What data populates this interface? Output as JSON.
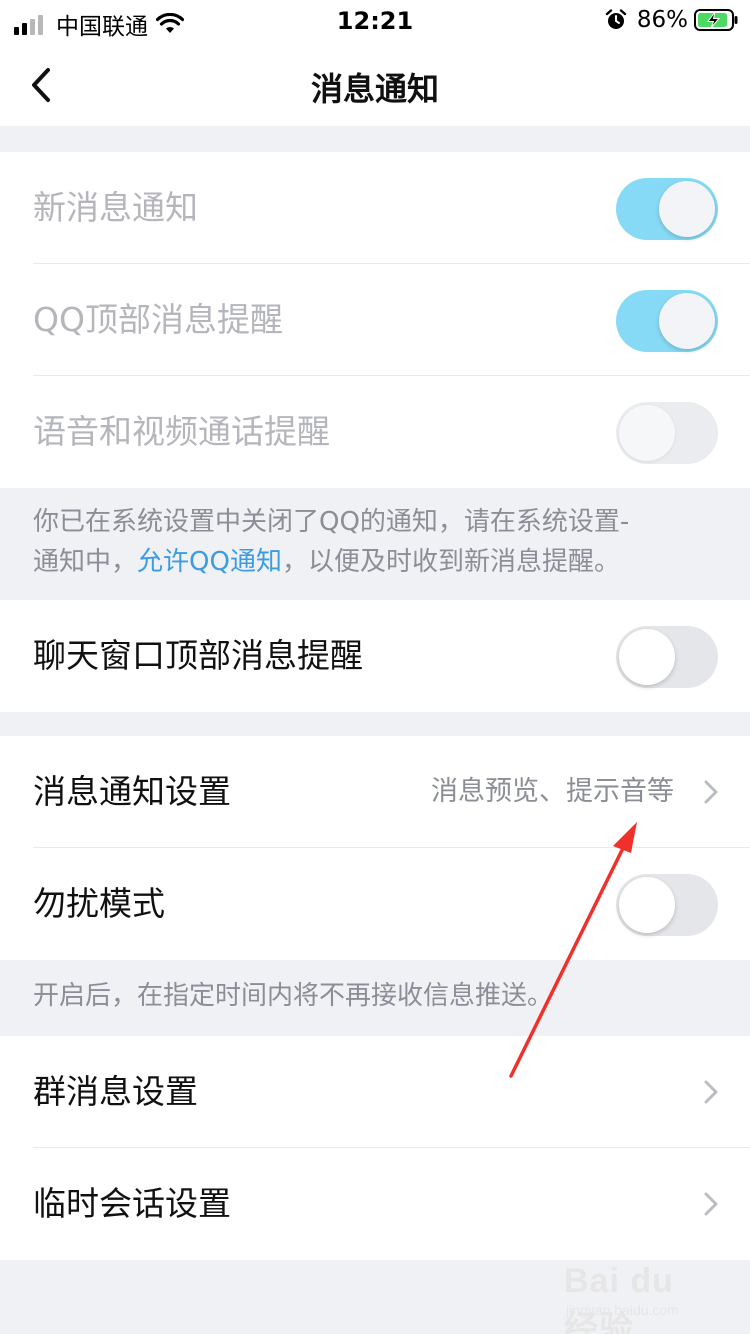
{
  "status_bar": {
    "carrier": "中国联通",
    "time": "12:21",
    "battery_percent": "86%",
    "icons": [
      "signal-icon",
      "wifi-icon",
      "alarm-icon",
      "battery-charging-icon"
    ]
  },
  "nav": {
    "title": "消息通知",
    "back_icon": "chevron-left-icon"
  },
  "group1": {
    "rows": [
      {
        "label": "新消息通知",
        "toggle": "on",
        "enabled": false
      },
      {
        "label": "QQ顶部消息提醒",
        "toggle": "on",
        "enabled": false
      },
      {
        "label": "语音和视频通话提醒",
        "toggle": "off",
        "enabled": false
      }
    ]
  },
  "system_note": {
    "line1": "你已在系统设置中关闭了QQ的通知，请在系统设置-",
    "line2_prefix": "通知中，",
    "link": "允许QQ通知",
    "line2_suffix": "，以便及时收到新消息提醒。"
  },
  "group2": {
    "rows": [
      {
        "label": "聊天窗口顶部消息提醒",
        "toggle": "off"
      }
    ]
  },
  "group3": {
    "rows": [
      {
        "label": "消息通知设置",
        "value": "消息预览、提示音等"
      },
      {
        "label": "勿扰模式",
        "toggle": "off"
      }
    ]
  },
  "dnd_note": "开启后，在指定时间内将不再接收信息推送。",
  "group4": {
    "rows": [
      {
        "label": "群消息设置"
      },
      {
        "label": "临时会话设置"
      }
    ]
  },
  "colors": {
    "toggle_on": "#86daf5",
    "toggle_off": "#e5e6ea",
    "link": "#3c9ce0",
    "annotation_arrow": "#f0302a",
    "page_background": "#f0f1f5"
  },
  "watermark": {
    "main": "Bai du 经验",
    "sub": "jingyan.baidu.com"
  }
}
